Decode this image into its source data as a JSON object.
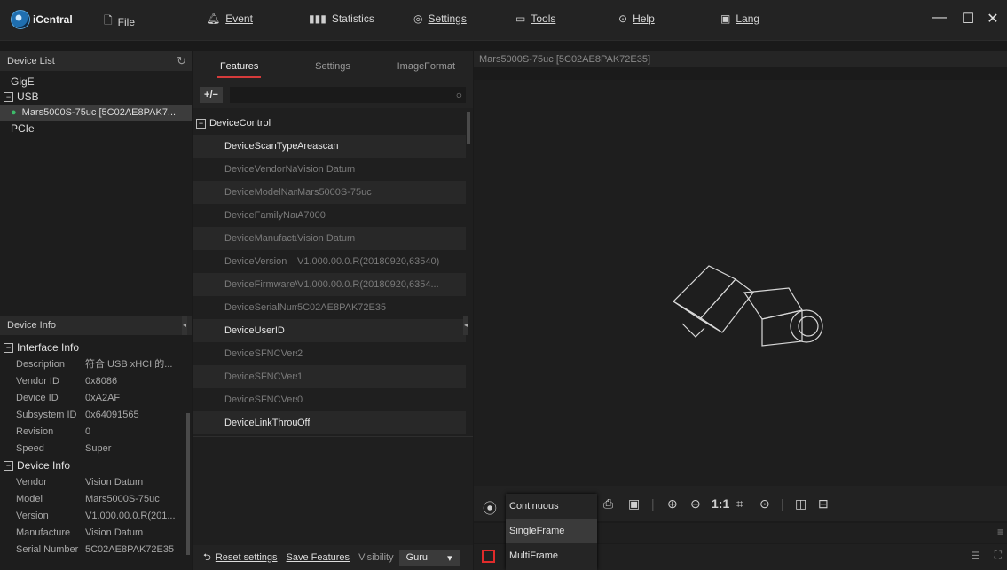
{
  "app": {
    "name": "iCentral"
  },
  "menu": [
    {
      "label": "File",
      "icon": "file-icon"
    },
    {
      "label": "Event",
      "icon": "bell-icon"
    },
    {
      "label": "Statistics",
      "icon": "bar-chart-icon"
    },
    {
      "label": "Settings",
      "icon": "gear-icon"
    },
    {
      "label": "Tools",
      "icon": "toolbox-icon"
    },
    {
      "label": "Help",
      "icon": "help-icon"
    },
    {
      "label": "Lang",
      "icon": "lang-icon"
    }
  ],
  "device_list": {
    "title": "Device List",
    "items": [
      {
        "label": "GigE"
      },
      {
        "label": "USB"
      },
      {
        "label": "Mars5000S-75uc [5C02AE8PAK7..."
      },
      {
        "label": "PCIe"
      }
    ]
  },
  "device_info": {
    "title": "Device Info",
    "groups": [
      {
        "title": "Interface Info",
        "rows": [
          {
            "k": "Description",
            "v": "符合 USB xHCI 的..."
          },
          {
            "k": "Vendor ID",
            "v": "0x8086"
          },
          {
            "k": "Device ID",
            "v": "0xA2AF"
          },
          {
            "k": "Subsystem ID",
            "v": "0x64091565"
          },
          {
            "k": "Revision",
            "v": "0"
          },
          {
            "k": "Speed",
            "v": "Super"
          }
        ]
      },
      {
        "title": "Device Info",
        "rows": [
          {
            "k": "Vendor",
            "v": "Vision Datum"
          },
          {
            "k": "Model",
            "v": "Mars5000S-75uc"
          },
          {
            "k": "Version",
            "v": "V1.000.00.0.R(201..."
          },
          {
            "k": "Manufacture",
            "v": "Vision Datum"
          },
          {
            "k": "Serial Number",
            "v": "5C02AE8PAK72E35"
          }
        ]
      }
    ]
  },
  "features": {
    "tabs": [
      "Features",
      "Settings",
      "ImageFormat"
    ],
    "pm_label": "+/−",
    "group": "DeviceControl",
    "rows": [
      {
        "n": "DeviceScanType",
        "v": "Areascan",
        "rw": true
      },
      {
        "n": "DeviceVendorName",
        "v": "Vision Datum",
        "rw": false
      },
      {
        "n": "DeviceModelName",
        "v": "Mars5000S-75uc",
        "rw": false
      },
      {
        "n": "DeviceFamilyName",
        "v": "A7000",
        "rw": false
      },
      {
        "n": "DeviceManufacturerInfo",
        "v": "Vision Datum",
        "rw": false
      },
      {
        "n": "DeviceVersion",
        "v": "V1.000.00.0.R(20180920,63540)",
        "rw": false
      },
      {
        "n": "DeviceFirmwareVersion",
        "v": "V1.000.00.0.R(20180920,6354...",
        "rw": false
      },
      {
        "n": "DeviceSerialNumber",
        "v": "5C02AE8PAK72E35",
        "rw": false
      },
      {
        "n": "DeviceUserID",
        "v": "",
        "rw": true
      },
      {
        "n": "DeviceSFNCVersionMajor",
        "v": "2",
        "rw": false
      },
      {
        "n": "DeviceSFNCVersionMinor",
        "v": "1",
        "rw": false
      },
      {
        "n": "DeviceSFNCVersionSu...",
        "v": "0",
        "rw": false
      },
      {
        "n": "DeviceLinkThroughput...",
        "v": "Off",
        "rw": true
      }
    ],
    "bottom": {
      "reset": "Reset settings",
      "save": "Save Features",
      "visibility_label": "Visibility",
      "visibility_value": "Guru"
    }
  },
  "image": {
    "title": "Mars5000S-75uc [5C02AE8PAK72E35]",
    "zoom_label": "1:1"
  },
  "acq_modes": [
    "Continuous",
    "SingleFrame",
    "MultiFrame"
  ]
}
